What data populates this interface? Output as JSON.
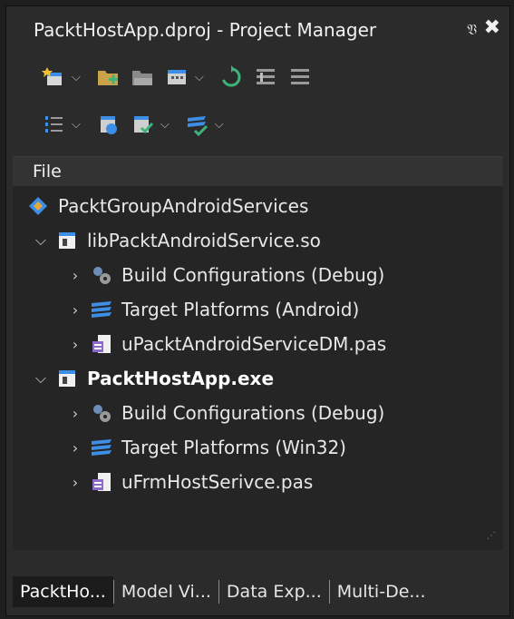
{
  "window": {
    "title": "PacktHostApp.dproj - Project Manager",
    "pin_icon": "pin-icon",
    "close_icon": "close-icon"
  },
  "toolbar_row1": [
    "new-item-icon",
    "add-existing-icon",
    "remove-icon",
    "view-icon",
    "sync-icon",
    "expand-icon",
    "collapse-icon"
  ],
  "toolbar_row2": [
    "build-order-icon",
    "build-icon",
    "check-icon",
    "platforms-icon"
  ],
  "header": {
    "column": "File"
  },
  "tree": {
    "group": "PacktGroupAndroidServices",
    "projects": [
      {
        "name": "libPacktAndroidService.so",
        "children": [
          "Build Configurations (Debug)",
          "Target Platforms (Android)",
          "uPacktAndroidServiceDM.pas"
        ]
      },
      {
        "name": "PacktHostApp.exe",
        "children": [
          "Build Configurations (Debug)",
          "Target Platforms (Win32)",
          "uFrmHostSerivce.pas"
        ]
      }
    ]
  },
  "tabs": [
    "PacktHo...",
    "Model Vi...",
    "Data Exp...",
    "Multi-De..."
  ],
  "colors": {
    "background": "#2b2b2b",
    "tree_bg": "#252525",
    "accent_blue": "#3c8ee6",
    "accent_green": "#3fb37a"
  }
}
